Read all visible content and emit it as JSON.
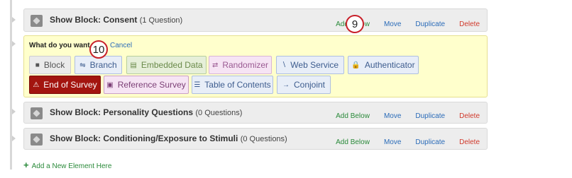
{
  "blocks": [
    {
      "label": "Show Block: Consent",
      "count": "(1 Question)"
    },
    {
      "label": "Show Block: Personality Questions",
      "count": "(0 Questions)"
    },
    {
      "label": "Show Block: Conditioning/Exposure to Stimuli",
      "count": "(0 Questions)"
    }
  ],
  "block_actions": {
    "add_below": "Add Below",
    "move": "Move",
    "duplicate": "Duplicate",
    "delete": "Delete"
  },
  "chooser": {
    "question": "What do you want to",
    "cancel": "Cancel",
    "options": [
      {
        "label": "Block",
        "icon": "cube-icon"
      },
      {
        "label": "Branch",
        "icon": "branch-icon"
      },
      {
        "label": "Embedded Data",
        "icon": "embedded-data-icon"
      },
      {
        "label": "Randomizer",
        "icon": "shuffle-icon"
      },
      {
        "label": "Web Service",
        "icon": "rss-icon"
      },
      {
        "label": "Authenticator",
        "icon": "lock-icon"
      },
      {
        "label": "End of Survey",
        "icon": "warning-icon"
      },
      {
        "label": "Reference Survey",
        "icon": "clipboard-icon"
      },
      {
        "label": "Table of Contents",
        "icon": "list-icon"
      },
      {
        "label": "Conjoint",
        "icon": "arrows-icon"
      }
    ]
  },
  "callouts": [
    "9",
    "10"
  ],
  "add_element": "Add a New Element Here",
  "colors": {
    "end_of_survey": "#a3150f",
    "callout_ring": "#c8202a",
    "chooser_bg": "#ffffcc"
  }
}
